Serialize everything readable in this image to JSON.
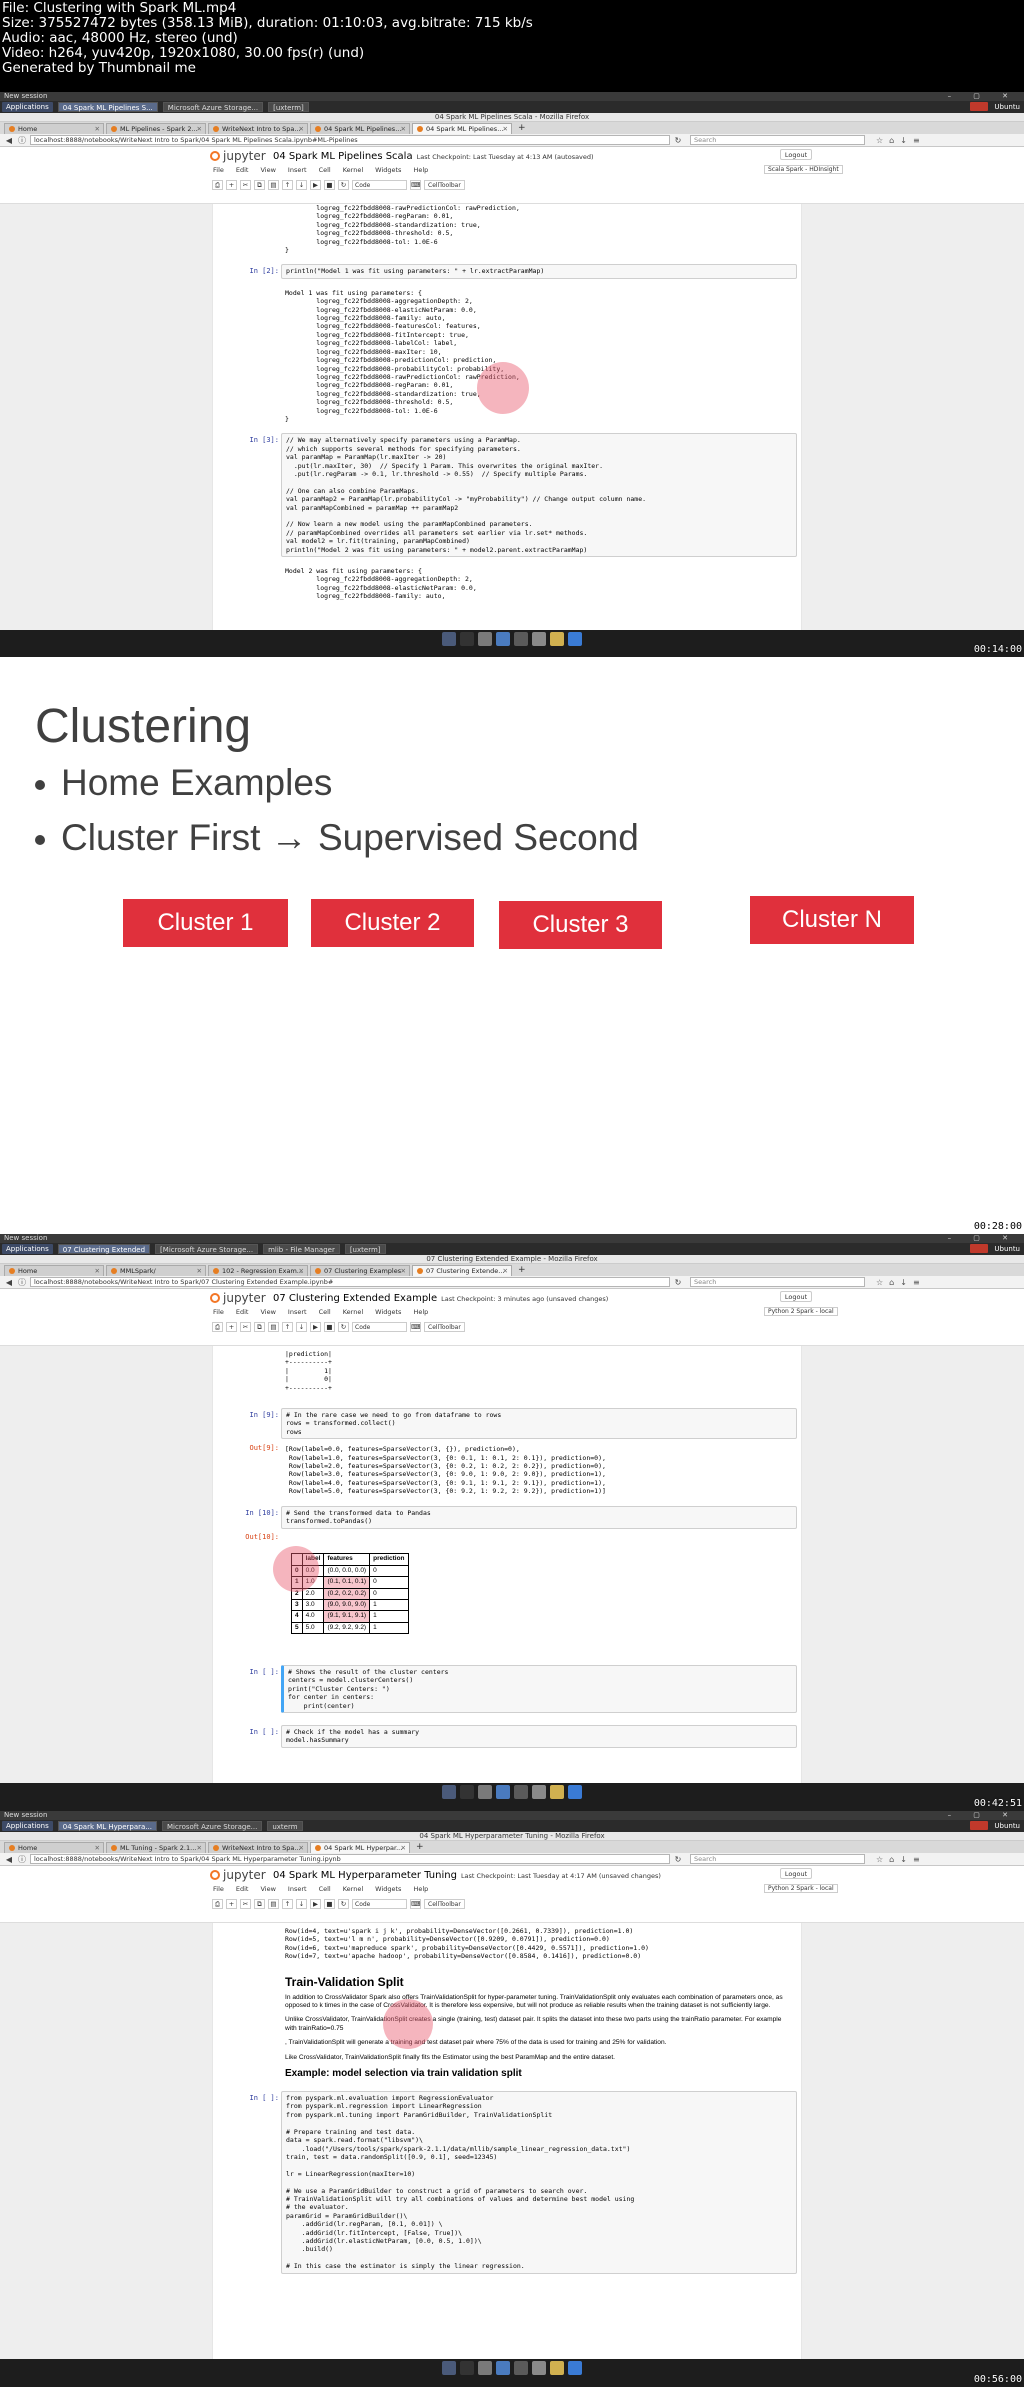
{
  "header_lines": [
    "File: Clustering with Spark ML.mp4",
    "Size: 375527472 bytes (358.13 MiB), duration: 01:10:03, avg.bitrate: 715 kb/s",
    "Audio: aac, 48000 Hz, stereo (und)",
    "Video: h264, yuv420p, 1920x1080, 30.00 fps(r) (und)",
    "Generated by Thumbnail me"
  ],
  "os": {
    "session_title": "New session",
    "applications": "Applications",
    "ubuntu": "Ubuntu"
  },
  "frame1": {
    "timestamp": "00:14:00",
    "tasks": [
      "04 Spark ML Pipelines S...",
      "Microsoft Azure Storage...",
      "[uxterm]"
    ],
    "window_title": "04 Spark ML Pipelines Scala - Mozilla Firefox",
    "tabs": [
      "Home",
      "ML Pipelines - Spark 2...",
      "WriteNext Intro to Spa...",
      "04 Spark ML Pipelines...",
      "04 Spark ML Pipelines..."
    ],
    "url": "localhost:8888/notebooks/WriteNext Intro to Spark/04 Spark ML Pipelines Scala.ipynb#ML-Pipelines",
    "search_placeholder": "Search",
    "logo": "jupyter",
    "notebook_title": "04 Spark ML Pipelines Scala",
    "checkpoint": "Last Checkpoint: Last Tuesday at 4:13 AM (autosaved)",
    "logout": "Logout",
    "kernel": "Scala Spark - HDInsight",
    "menu": [
      "File",
      "Edit",
      "View",
      "Insert",
      "Cell",
      "Kernel",
      "Widgets",
      "Help"
    ],
    "cell_type": "Code",
    "celltoolbar": "CellToolbar",
    "top_output": "        logreg_fc22fbdd8008-rawPredictionCol: rawPrediction,\n        logreg_fc22fbdd8008-regParam: 0.01,\n        logreg_fc22fbdd8008-standardization: true,\n        logreg_fc22fbdd8008-threshold: 0.5,\n        logreg_fc22fbdd8008-tol: 1.0E-6\n}",
    "cell2_prompt": "In [2]:",
    "cell2_code": "println(\"Model 1 was fit using parameters: \" + lr.extractParamMap)",
    "cell2_output": "Model 1 was fit using parameters: {\n        logreg_fc22fbdd8008-aggregationDepth: 2,\n        logreg_fc22fbdd8008-elasticNetParam: 0.0,\n        logreg_fc22fbdd8008-family: auto,\n        logreg_fc22fbdd8008-featuresCol: features,\n        logreg_fc22fbdd8008-fitIntercept: true,\n        logreg_fc22fbdd8008-labelCol: label,\n        logreg_fc22fbdd8008-maxIter: 10,\n        logreg_fc22fbdd8008-predictionCol: prediction,\n        logreg_fc22fbdd8008-probabilityCol: probability,\n        logreg_fc22fbdd8008-rawPredictionCol: rawPrediction,\n        logreg_fc22fbdd8008-regParam: 0.01,\n        logreg_fc22fbdd8008-standardization: true,\n        logreg_fc22fbdd8008-threshold: 0.5,\n        logreg_fc22fbdd8008-tol: 1.0E-6\n}",
    "cell3_prompt": "In [3]:",
    "cell3_code": "// We may alternatively specify parameters using a ParamMap.\n// which supports several methods for specifying parameters.\nval paramMap = ParamMap(lr.maxIter -> 20)\n  .put(lr.maxIter, 30)  // Specify 1 Param. This overwrites the original maxIter.\n  .put(lr.regParam -> 0.1, lr.threshold -> 0.55)  // Specify multiple Params.\n\n// One can also combine ParamMaps.\nval paramMap2 = ParamMap(lr.probabilityCol -> \"myProbability\") // Change output column name.\nval paramMapCombined = paramMap ++ paramMap2\n\n// Now learn a new model using the paramMapCombined parameters.\n// paramMapCombined overrides all parameters set earlier via lr.set* methods.\nval model2 = lr.fit(training, paramMapCombined)\nprintln(\"Model 2 was fit using parameters: \" + model2.parent.extractParamMap)",
    "cell3_output": "Model 2 was fit using parameters: {\n        logreg_fc22fbdd8008-aggregationDepth: 2,\n        logreg_fc22fbdd8008-elasticNetParam: 0.0,\n        logreg_fc22fbdd8008-family: auto,"
  },
  "frame2": {
    "timestamp": "00:28:00",
    "title": "Clustering",
    "bullets": [
      "Home Examples",
      "Cluster First → Supervised Second"
    ],
    "clusters": [
      "Cluster 1",
      "Cluster 2",
      "Cluster 3",
      "Cluster N"
    ]
  },
  "frame3": {
    "timestamp": "00:42:51",
    "tasks": [
      "07 Clustering Extended",
      "[Microsoft Azure Storage...",
      "mlib - File Manager",
      "[uxterm]"
    ],
    "window_title": "07 Clustering Extended Example - Mozilla Firefox",
    "tabs": [
      "Home",
      "MMLSpark/",
      "102 - Regression Exam...",
      "07 Clustering Examples",
      "07 Clustering Extende..."
    ],
    "url": "localhost:8888/notebooks/WriteNext Intro to Spark/07 Clustering Extended Example.ipynb#",
    "search_placeholder": "Search",
    "logo": "jupyter",
    "notebook_title": "07 Clustering Extended Example",
    "checkpoint": "Last Checkpoint: 3 minutes ago (unsaved changes)",
    "logout": "Logout",
    "kernel": "Python 2 Spark - local",
    "menu": [
      "File",
      "Edit",
      "View",
      "Insert",
      "Cell",
      "Kernel",
      "Widgets",
      "Help"
    ],
    "cell_type": "Code",
    "celltoolbar": "CellToolbar",
    "top_output": "|prediction|\n+----------+\n|         1|\n|         0|\n+----------+",
    "cell9_prompt": "In [9]:",
    "cell9_code": "# In the rare case we need to go from dataframe to rows\nrows = transformed.collect()\nrows",
    "out9_prompt": "Out[9]:",
    "out9": "[Row(label=0.0, features=SparseVector(3, {}), prediction=0),\n Row(label=1.0, features=SparseVector(3, {0: 0.1, 1: 0.1, 2: 0.1}), prediction=0),\n Row(label=2.0, features=SparseVector(3, {0: 0.2, 1: 0.2, 2: 0.2}), prediction=0),\n Row(label=3.0, features=SparseVector(3, {0: 9.0, 1: 9.0, 2: 9.0}), prediction=1),\n Row(label=4.0, features=SparseVector(3, {0: 9.1, 1: 9.1, 2: 9.1}), prediction=1),\n Row(label=5.0, features=SparseVector(3, {0: 9.2, 1: 9.2, 2: 9.2}), prediction=1)]",
    "cell10_prompt": "In [10]:",
    "cell10_code": "# Send the transformed data to Pandas\ntransformed.toPandas()",
    "out10_prompt": "Out[10]:",
    "table": {
      "headers": [
        "",
        "label",
        "features",
        "prediction"
      ],
      "rows": [
        [
          "0",
          "0.0",
          "(0.0, 0.0, 0.0)",
          "0"
        ],
        [
          "1",
          "1.0",
          "(0.1, 0.1, 0.1)",
          "0"
        ],
        [
          "2",
          "2.0",
          "(0.2, 0.2, 0.2)",
          "0"
        ],
        [
          "3",
          "3.0",
          "(9.0, 9.0, 9.0)",
          "1"
        ],
        [
          "4",
          "4.0",
          "(9.1, 9.1, 9.1)",
          "1"
        ],
        [
          "5",
          "5.0",
          "(9.2, 9.2, 9.2)",
          "1"
        ]
      ]
    },
    "cellA_prompt": "In [ ]:",
    "cellA_code": "# Shows the result of the cluster centers\ncenters = model.clusterCenters()\nprint(\"Cluster Centers: \")\nfor center in centers:\n    print(center)",
    "cellB_prompt": "In [ ]:",
    "cellB_code": "# Check if the model has a summary\nmodel.hasSummary"
  },
  "frame4": {
    "timestamp": "00:56:00",
    "tasks": [
      "04 Spark ML Hyperpara...",
      "Microsoft Azure Storage...",
      "uxterm"
    ],
    "window_title": "04 Spark ML Hyperparameter Tuning - Mozilla Firefox",
    "tabs": [
      "Home",
      "ML Tuning - Spark 2.1...",
      "WriteNext Intro to Spa...",
      "04 Spark ML Hyperpar..."
    ],
    "url": "localhost:8888/notebooks/WriteNext Intro to Spark/04 Spark ML Hyperparameter Tuning.ipynb",
    "search_placeholder": "Search",
    "logo": "jupyter",
    "notebook_title": "04 Spark ML Hyperparameter Tuning",
    "checkpoint": "Last Checkpoint: Last Tuesday at 4:17 AM (unsaved changes)",
    "logout": "Logout",
    "kernel": "Python 2 Spark - local",
    "menu": [
      "File",
      "Edit",
      "View",
      "Insert",
      "Cell",
      "Kernel",
      "Widgets",
      "Help"
    ],
    "cell_type": "Code",
    "celltoolbar": "CellToolbar",
    "top_output": "Row(id=4, text=u'spark i j k', probability=DenseVector([0.2661, 0.7339]), prediction=1.0)\nRow(id=5, text=u'l m n', probability=DenseVector([0.9209, 0.0791]), prediction=0.0)\nRow(id=6, text=u'mapreduce spark', probability=DenseVector([0.4429, 0.5571]), prediction=1.0)\nRow(id=7, text=u'apache hadoop', probability=DenseVector([0.8584, 0.1416]), prediction=0.0)",
    "md_heading": "Train-Validation Split",
    "md_p1": "In addition to CrossValidator Spark also offers TrainValidationSplit for hyper-parameter tuning. TrainValidationSplit only evaluates each combination of parameters once, as opposed to k times in the case of CrossValidator. It is therefore less expensive, but will not produce as reliable results when the training dataset is not sufficiently large.",
    "md_p2": "Unlike CrossValidator, TrainValidationSplit creates a single (training, test) dataset pair. It splits the dataset into these two parts using the trainRatio parameter. For example with trainRatio=0.75",
    "md_p3": ", TrainValidationSplit will generate a training and test dataset pair where 75% of the data is used for training and 25% for validation.",
    "md_p4": "Like CrossValidator, TrainValidationSplit finally fits the Estimator using the best ParamMap and the entire dataset.",
    "md_h3": "Example: model selection via train validation split",
    "cell_prompt": "In [ ]:",
    "cell_code": "from pyspark.ml.evaluation import RegressionEvaluator\nfrom pyspark.ml.regression import LinearRegression\nfrom pyspark.ml.tuning import ParamGridBuilder, TrainValidationSplit\n\n# Prepare training and test data.\ndata = spark.read.format(\"libsvm\")\\\n    .load(\"/Users/tools/spark/spark-2.1.1/data/mllib/sample_linear_regression_data.txt\")\ntrain, test = data.randomSplit([0.9, 0.1], seed=12345)\n\nlr = LinearRegression(maxIter=10)\n\n# We use a ParamGridBuilder to construct a grid of parameters to search over.\n# TrainValidationSplit will try all combinations of values and determine best model using\n# the evaluator.\nparamGrid = ParamGridBuilder()\\\n    .addGrid(lr.regParam, [0.1, 0.01]) \\\n    .addGrid(lr.fitIntercept, [False, True])\\\n    .addGrid(lr.elasticNetParam, [0.0, 0.5, 1.0])\\\n    .build()\n\n# In this case the estimator is simply the linear regression."
  }
}
